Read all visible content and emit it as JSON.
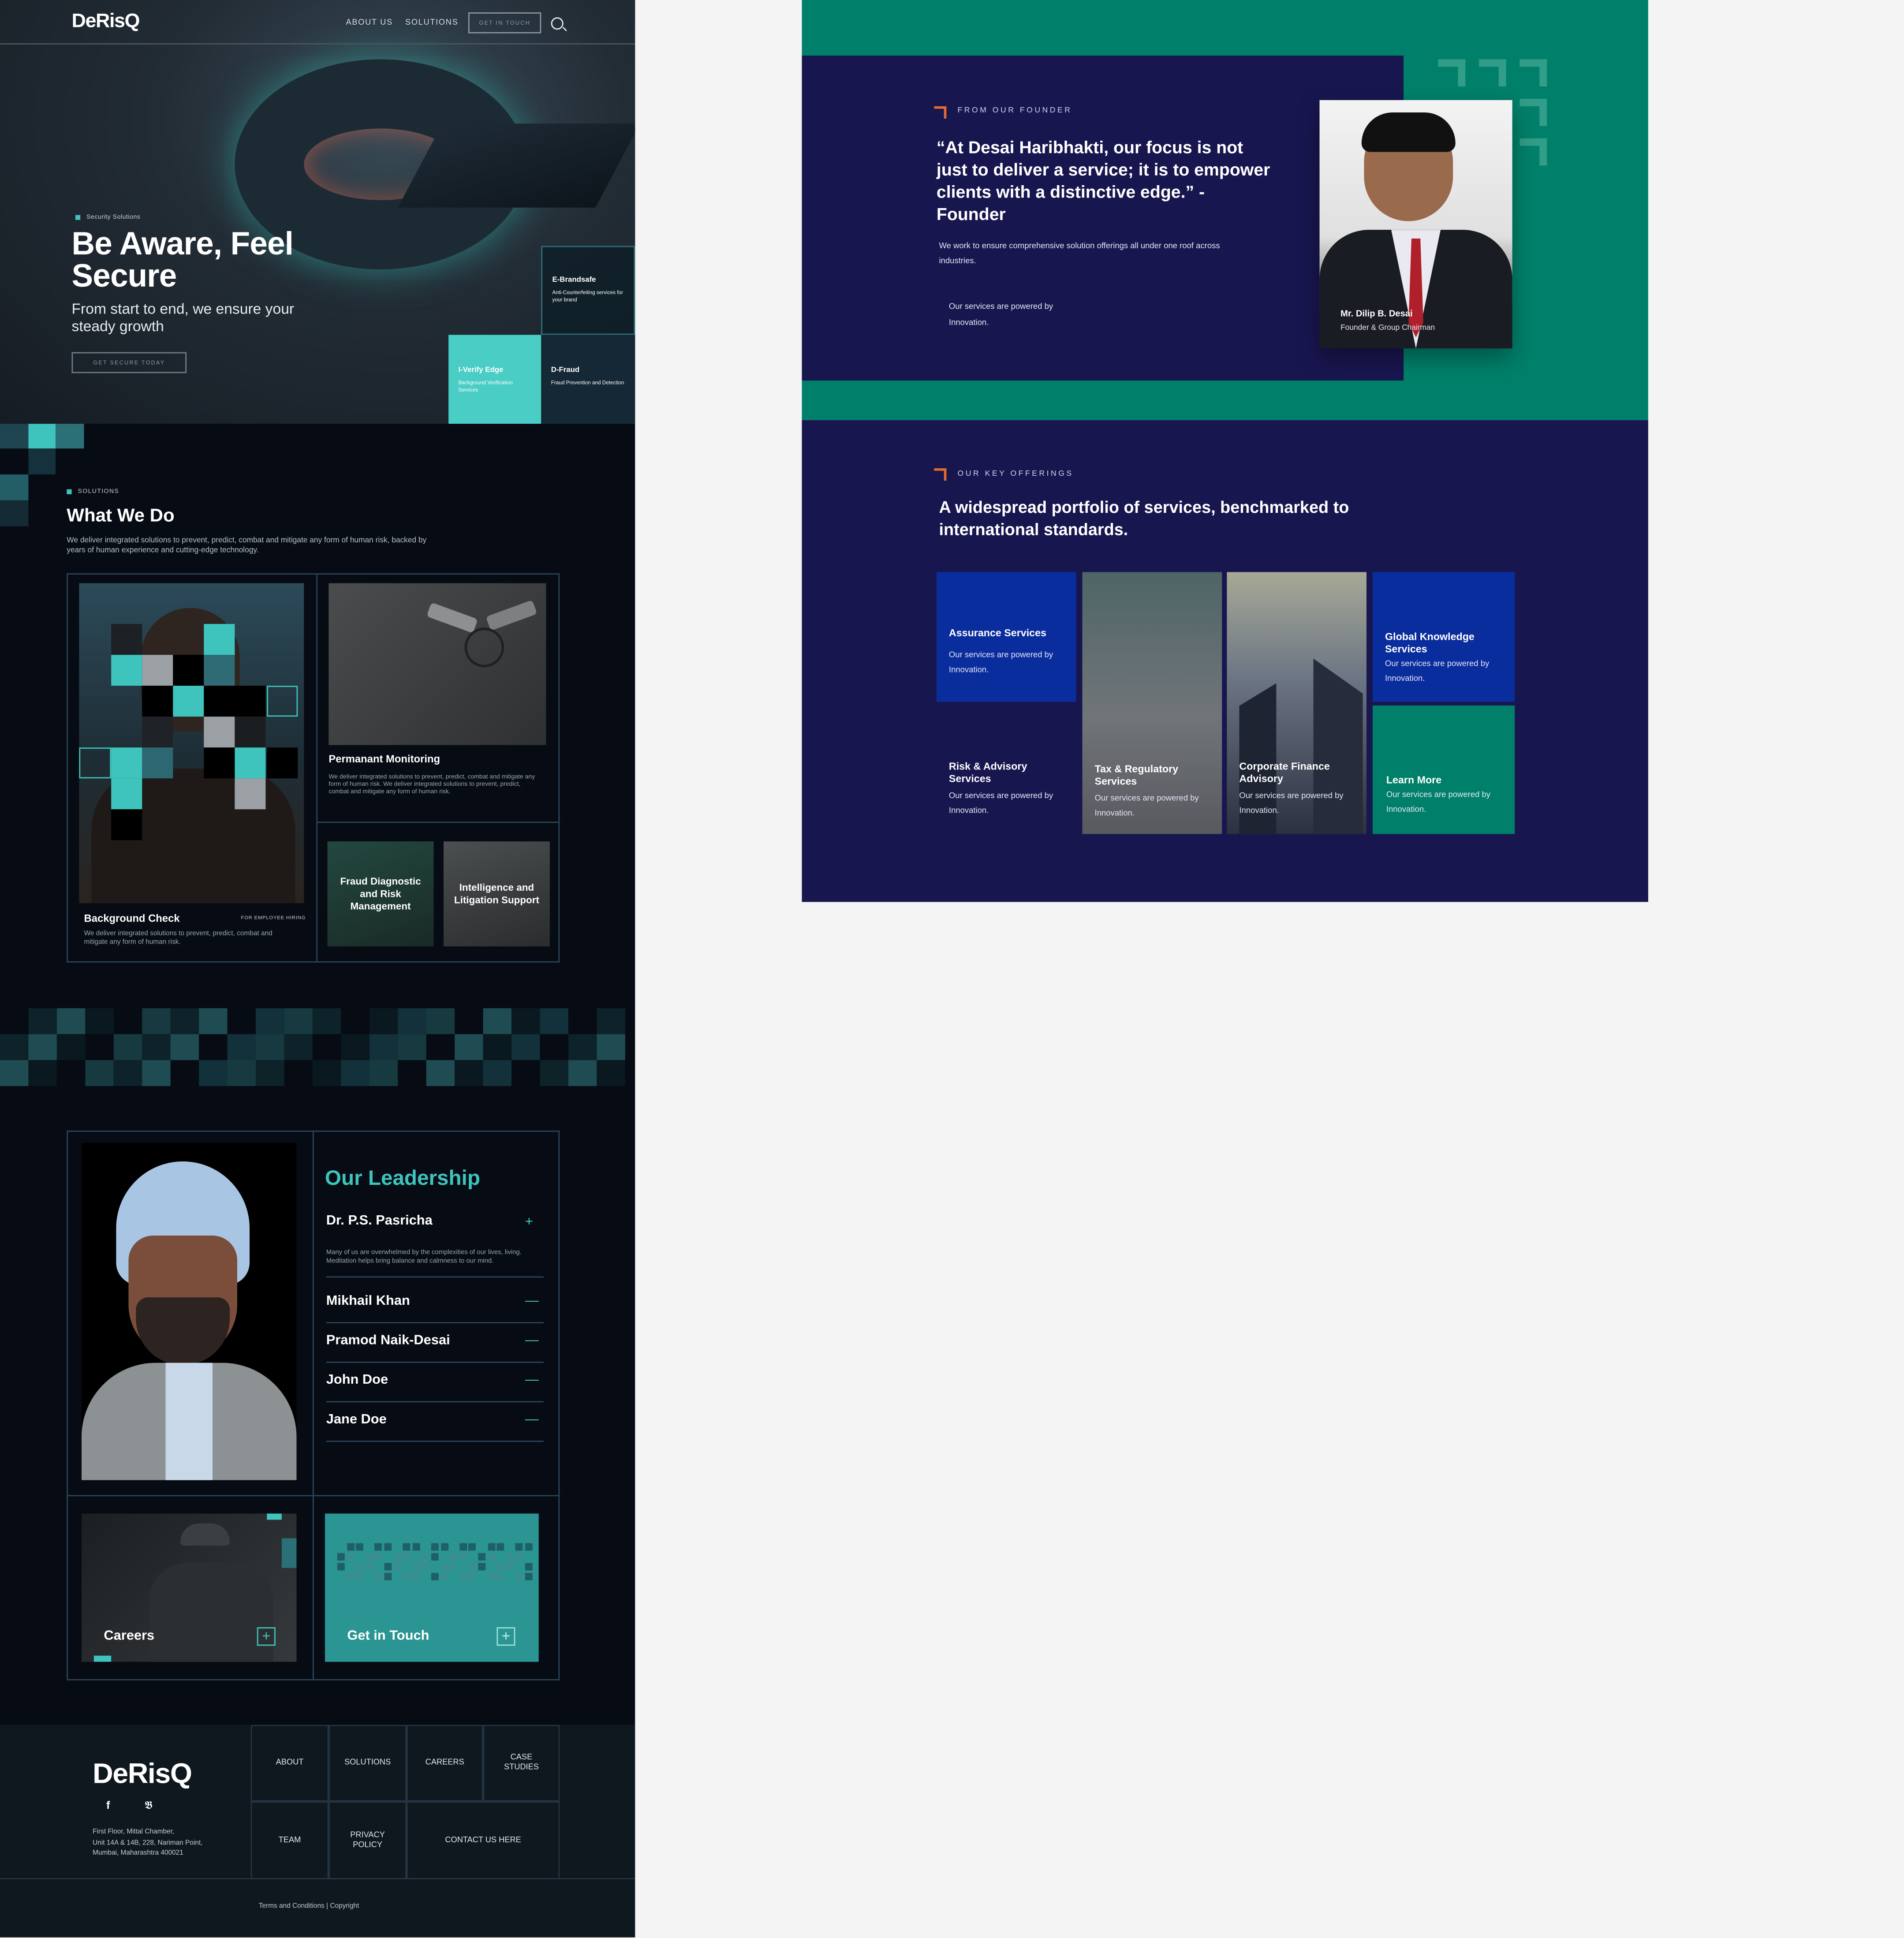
{
  "header": {
    "logo": "DeRisQ",
    "nav": [
      "ABOUT US",
      "SOLUTIONS"
    ],
    "cta": "GET IN TOUCH"
  },
  "hero": {
    "tag": "Security Solutions",
    "title": "Be Aware, Feel Secure",
    "subtitle": "From start to end, we ensure your steady growth",
    "button": "GET SECURE TODAY",
    "tiles": [
      {
        "title": "E-Brandsafe",
        "desc": "Anti-Counterfeiting services for your brand"
      },
      {
        "title": "I-Verify Edge",
        "desc": "Background Verification Services"
      },
      {
        "title": "D-Fraud",
        "desc": "Fraud Prevention and Detection"
      }
    ]
  },
  "solutions": {
    "tag": "SOLUTIONS",
    "title": "What We Do",
    "desc": "We deliver integrated solutions to prevent, predict, combat and mitigate any form of human risk, backed by years of human experience and cutting-edge technology.",
    "card1": {
      "title": "Background Check",
      "badge": "FOR EMPLOYEE HIRING",
      "desc": "We deliver integrated solutions to prevent, predict, combat and mitigate any form of human risk."
    },
    "card2": {
      "title": "Permanant Monitoring",
      "desc": "We deliver integrated solutions to prevent, predict, combat and mitigate any form of human risk. We deliver integrated solutions to prevent, predict, combat and mitigate any form of human risk."
    },
    "card3": {
      "title": "Fraud Diagnostic and Risk Management"
    },
    "card4": {
      "title": "Intelligence and Litigation Support"
    }
  },
  "leadership": {
    "title": "Our Leadership",
    "people": [
      {
        "name": "Dr. P.S. Pasricha",
        "icon": "+",
        "desc": "Many of us are overwhelmed by the complexities of our lives, living. Meditation helps bring balance and calmness to our mind."
      },
      {
        "name": "Mikhail Khan",
        "icon": "—"
      },
      {
        "name": "Pramod Naik-Desai",
        "icon": "—"
      },
      {
        "name": "John Doe",
        "icon": "—"
      },
      {
        "name": "Jane Doe",
        "icon": "—"
      }
    ],
    "careers": "Careers",
    "contact": "Get in Touch"
  },
  "footer": {
    "logo": "DeRisQ",
    "address": [
      "First Floor, Mittal Chamber,",
      "Unit 14A & 14B, 228, Nariman Point,",
      "Mumbai, Maharashtra 400021"
    ],
    "links": [
      "ABOUT",
      "SOLUTIONS",
      "CAREERS",
      "CASE STUDIES",
      "TEAM",
      "PRIVACY POLICY",
      "CONTACT US HERE"
    ],
    "copyright": "Terms and Conditions | Copyright",
    "social": [
      "facebook-icon",
      "twitter-icon"
    ]
  },
  "founder": {
    "eyebrow": "FROM OUR FOUNDER",
    "quote": "“At Desai Haribhakti, our focus is not just to deliver a service; it is to empower clients with a distinctive edge.” - Founder",
    "desc": "We work to ensure comprehensive solution offerings all under one roof across industries.",
    "powered": "Our services are powered by Innovation.",
    "name": "Mr. Dilip B. Desai",
    "role": "Founder & Group Chairman"
  },
  "offerings": {
    "eyebrow": "OUR KEY OFFERINGS",
    "title": "A widespread portfolio of services, benchmarked to international standards.",
    "items": [
      {
        "title": "Assurance Services",
        "desc": "Our services are powered by Innovation."
      },
      {
        "title": "Risk & Advisory Services",
        "desc": "Our services are powered by Innovation."
      },
      {
        "title": "Tax & Regulatory Services",
        "desc": "Our services are powered by Innovation."
      },
      {
        "title": "Corporate Finance Advisory",
        "desc": "Our services are powered by Innovation."
      },
      {
        "title": "Global Knowledge Services",
        "desc": "Our services are powered by Innovation."
      },
      {
        "title": "Learn More",
        "desc": "Our services are powered by Innovation."
      }
    ]
  },
  "colors": {
    "teal": "#3ec4bd",
    "navy": "#18164f",
    "green": "#00806a",
    "blue": "#0a2d9e",
    "orange": "#e36b2b"
  }
}
